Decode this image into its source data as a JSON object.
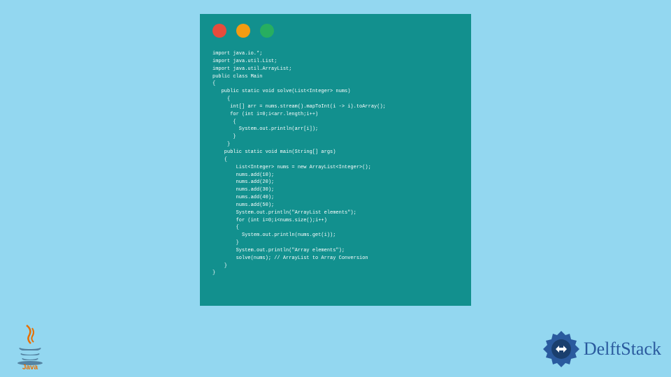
{
  "code": {
    "line1": "import java.io.*;",
    "line2": "import java.util.List;",
    "line3": "import java.util.ArrayList;",
    "line4": "public class Main",
    "line5": "{",
    "line6": "   public static void solve(List<Integer> nums)",
    "line7": "     {",
    "line8": "      int[] arr = nums.stream().mapToInt(i -> i).toArray();",
    "line9": "      for (int i=0;i<arr.length;i++)",
    "line10": "       {",
    "line11": "         System.out.println(arr[i]);",
    "line12": "       }",
    "line13": "     }",
    "line14": "    public static void main(String[] args)",
    "line15": "    {",
    "line16": "        List<Integer> nums = new ArrayList<Integer>();",
    "line17": "        nums.add(10);",
    "line18": "        nums.add(20);",
    "line19": "        nums.add(30);",
    "line20": "        nums.add(40);",
    "line21": "        nums.add(50);",
    "line22": "        System.out.println(\"ArrayList elements\");",
    "line23": "        for (int i=0;i<nums.size();i++)",
    "line24": "        {",
    "line25": "          System.out.println(nums.get(i));",
    "line26": "        }",
    "line27": "        System.out.println(\"Array elements\");",
    "line28": "        solve(nums); // ArrayList to Array Conversion",
    "line29": "    }",
    "line30": "}"
  },
  "logos": {
    "java": "Java",
    "delft": "DelftStack"
  }
}
